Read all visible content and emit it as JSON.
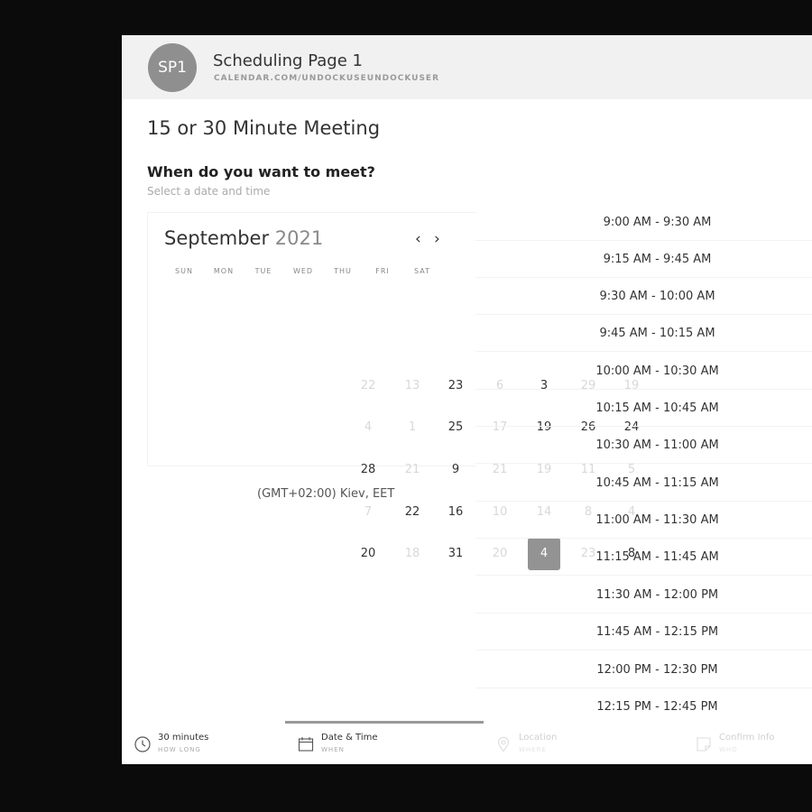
{
  "header": {
    "avatar_initials": "SP1",
    "title": "Scheduling Page 1",
    "url": "CALENDAR.COM/UNDOCKUSEUNDOCKUSER"
  },
  "meeting": {
    "title": "15 or 30 Minute Meeting",
    "question": "When do you want to meet?",
    "subtext": "Select a date and time"
  },
  "calendar": {
    "month": "September",
    "year": "2021",
    "prev_arrow": "‹",
    "next_arrow": "›",
    "weekdays": [
      "SUN",
      "MON",
      "TUE",
      "WED",
      "THU",
      "FRI",
      "SAT"
    ],
    "days": [
      "22",
      "13",
      "23",
      "6",
      "3",
      "29",
      "19",
      "4",
      "1",
      "25",
      "17",
      "19",
      "26",
      "24",
      "28",
      "21",
      "9",
      "21",
      "19",
      "11",
      "5",
      "7",
      "22",
      "16",
      "10",
      "14",
      "8",
      "4",
      "20",
      "18",
      "31",
      "20",
      "4",
      "23",
      "8"
    ],
    "selected_day": "4",
    "timezone": "(GMT+02:00) Kiev, EET"
  },
  "timeslots": [
    "9:00 AM - 9:30 AM",
    "9:15 AM - 9:45 AM",
    "9:30 AM - 10:00 AM",
    "9:45 AM - 10:15 AM",
    "10:00 AM - 10:30 AM",
    "10:15 AM - 10:45 AM",
    "10:30 AM - 11:00 AM",
    "10:45 AM - 11:15 AM",
    "11:00 AM - 11:30 AM",
    "11:15 AM - 11:45 AM",
    "11:30 AM - 12:00 PM",
    "11:45 AM - 12:15 PM",
    "12:00 PM - 12:30 PM",
    "12:15 PM - 12:45 PM"
  ],
  "tabs": [
    {
      "label": "30 minutes",
      "sub": "HOW LONG",
      "icon": "clock-icon"
    },
    {
      "label": "Date & Time",
      "sub": "WHEN",
      "icon": "calendar-icon"
    },
    {
      "label": "Location",
      "sub": "WHERE",
      "icon": "location-pin-icon"
    },
    {
      "label": "Confirm Info",
      "sub": "WHO",
      "icon": "note-icon"
    }
  ]
}
